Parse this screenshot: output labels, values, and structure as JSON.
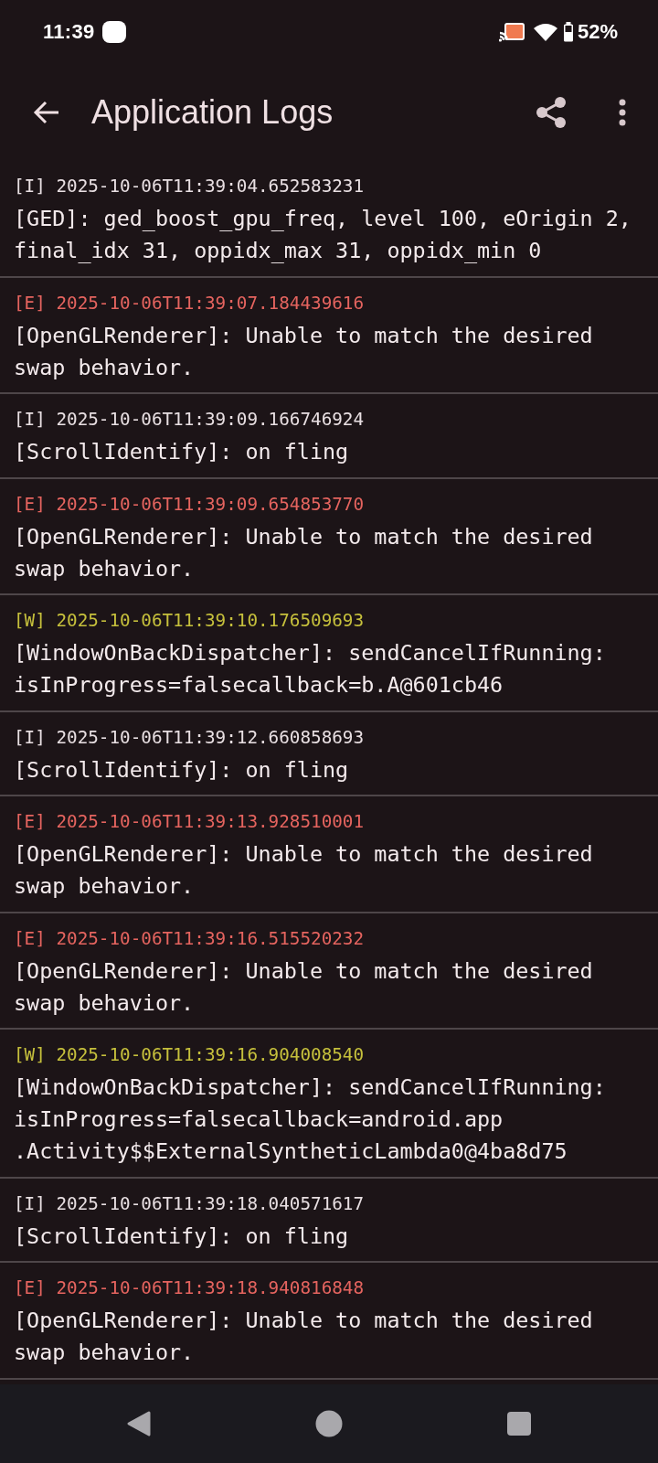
{
  "status_bar": {
    "time": "11:39",
    "battery": "52%"
  },
  "app_bar": {
    "title": "Application Logs"
  },
  "logs": [
    {
      "kind": "info",
      "tag": "[I]",
      "timestamp": "2025-10-06T11:39:04.652583231",
      "lines": [
        "[GED]: ged_boost_gpu_freq, level 100, eOrigin 2,",
        "final_idx 31, oppidx_max 31, oppidx_min 0"
      ]
    },
    {
      "kind": "error",
      "tag": "[E]",
      "timestamp": "2025-10-06T11:39:07.184439616",
      "lines": [
        "[OpenGLRenderer]: Unable to match the desired",
        "swap behavior."
      ]
    },
    {
      "kind": "info",
      "tag": "[I]",
      "timestamp": "2025-10-06T11:39:09.166746924",
      "lines": [
        "[ScrollIdentify]: on fling"
      ]
    },
    {
      "kind": "error",
      "tag": "[E]",
      "timestamp": "2025-10-06T11:39:09.654853770",
      "lines": [
        "[OpenGLRenderer]: Unable to match the desired",
        "swap behavior."
      ]
    },
    {
      "kind": "warning",
      "tag": "[W]",
      "timestamp": "2025-10-06T11:39:10.176509693",
      "lines": [
        "[WindowOnBackDispatcher]: sendCancelIfRunning:",
        "isInProgress=falsecallback=b.A@601cb46"
      ]
    },
    {
      "kind": "info",
      "tag": "[I]",
      "timestamp": "2025-10-06T11:39:12.660858693",
      "lines": [
        "[ScrollIdentify]: on fling"
      ]
    },
    {
      "kind": "error",
      "tag": "[E]",
      "timestamp": "2025-10-06T11:39:13.928510001",
      "lines": [
        "[OpenGLRenderer]: Unable to match the desired",
        "swap behavior."
      ]
    },
    {
      "kind": "error",
      "tag": "[E]",
      "timestamp": "2025-10-06T11:39:16.515520232",
      "lines": [
        "[OpenGLRenderer]: Unable to match the desired",
        "swap behavior."
      ]
    },
    {
      "kind": "warning",
      "tag": "[W]",
      "timestamp": "2025-10-06T11:39:16.904008540",
      "lines": [
        "[WindowOnBackDispatcher]: sendCancelIfRunning:",
        "isInProgress=falsecallback=android.app",
        ".Activity$$ExternalSyntheticLambda0@4ba8d75"
      ]
    },
    {
      "kind": "info",
      "tag": "[I]",
      "timestamp": "2025-10-06T11:39:18.040571617",
      "lines": [
        "[ScrollIdentify]: on fling"
      ]
    },
    {
      "kind": "error",
      "tag": "[E]",
      "timestamp": "2025-10-06T11:39:18.940816848",
      "lines": [
        "[OpenGLRenderer]: Unable to match the desired",
        "swap behavior."
      ]
    }
  ]
}
